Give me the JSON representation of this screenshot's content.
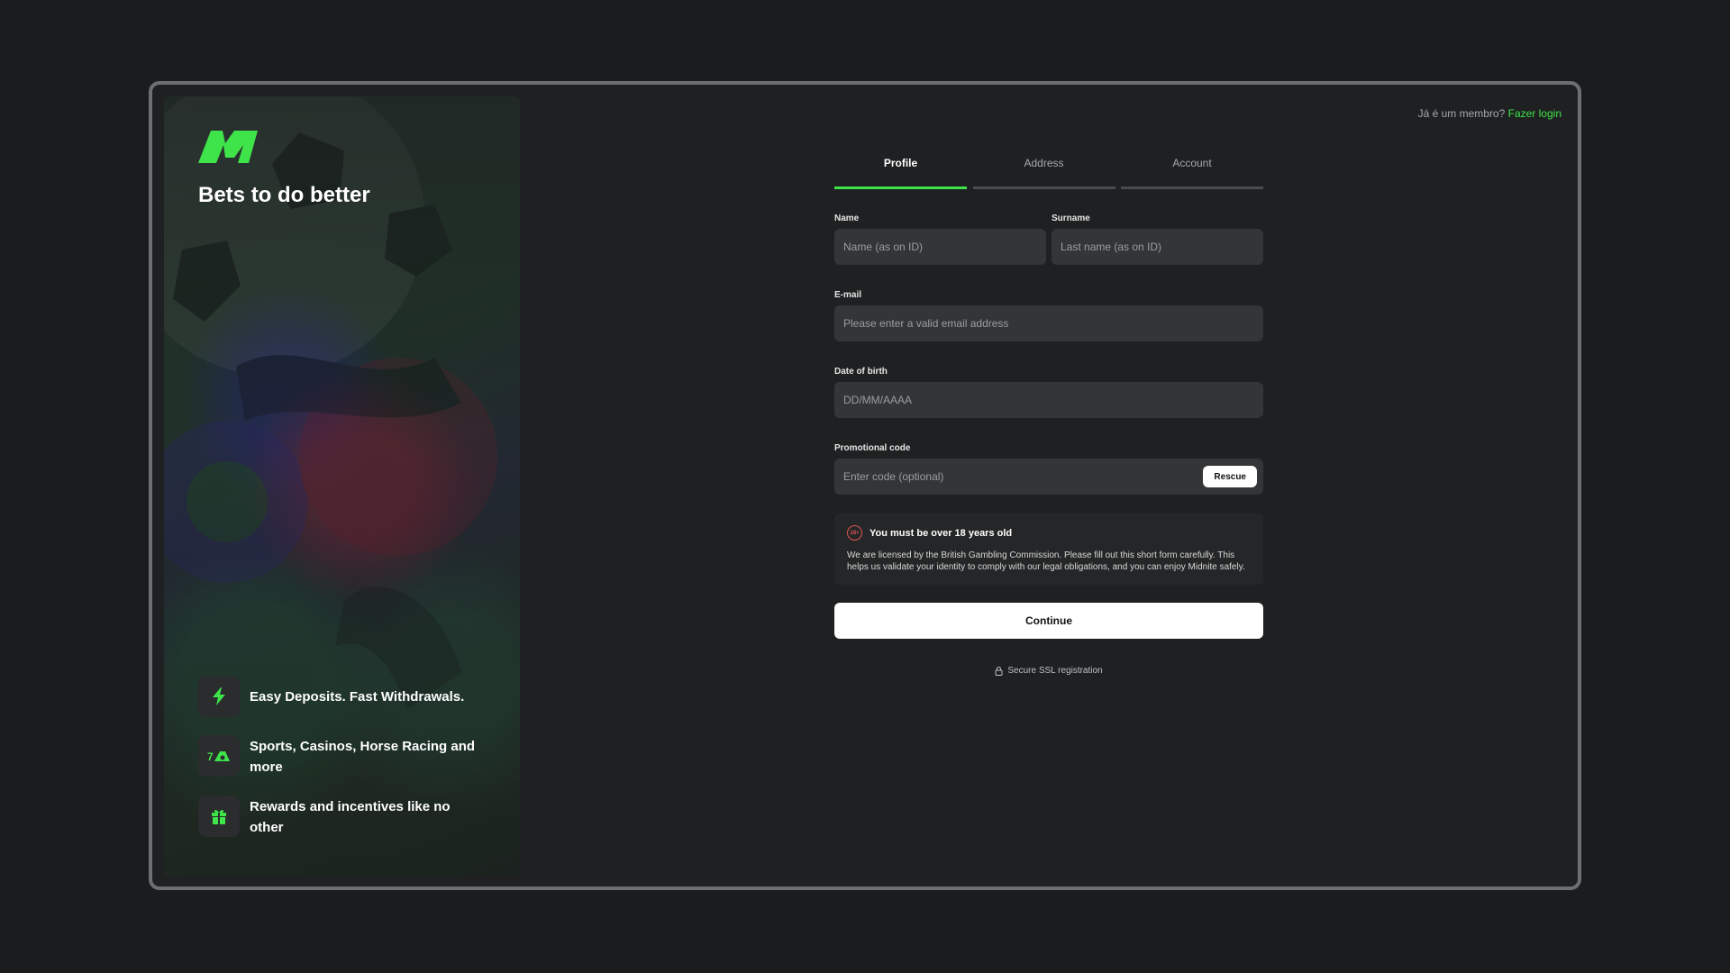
{
  "brand": {
    "tagline": "Bets to do better",
    "accent_color": "#3fe34a"
  },
  "features": [
    {
      "icon": "lightning-icon",
      "text": "Easy Deposits. Fast Withdrawals."
    },
    {
      "icon": "sports-casino-icon",
      "text": "Sports, Casinos, Horse Racing and more"
    },
    {
      "icon": "gift-icon",
      "text": "Rewards and incentives like no other"
    }
  ],
  "login": {
    "prompt": "Já é um membro?",
    "link_label": "Fazer login"
  },
  "tabs": [
    {
      "label": "Profile",
      "active": true
    },
    {
      "label": "Address",
      "active": false
    },
    {
      "label": "Account",
      "active": false
    }
  ],
  "form": {
    "name": {
      "label": "Name",
      "placeholder": "Name (as on ID)",
      "value": ""
    },
    "surname": {
      "label": "Surname",
      "placeholder": "Last name (as on ID)",
      "value": ""
    },
    "email": {
      "label": "E-mail",
      "placeholder": "Please enter a valid email address",
      "value": ""
    },
    "dob": {
      "label": "Date of birth",
      "placeholder": "DD/MM/AAAA",
      "value": ""
    },
    "promo": {
      "label": "Promotional code",
      "placeholder": "Enter code (optional)",
      "value": "",
      "button_label": "Rescue"
    }
  },
  "notice": {
    "badge": "18+",
    "title": "You must be over 18 years old",
    "body": "We are licensed by the British Gambling Commission. Please fill out this short form carefully. This helps us validate your identity to comply with our legal obligations, and you can enjoy Midnite safely."
  },
  "continue_label": "Continue",
  "ssl_text": "Secure SSL registration"
}
